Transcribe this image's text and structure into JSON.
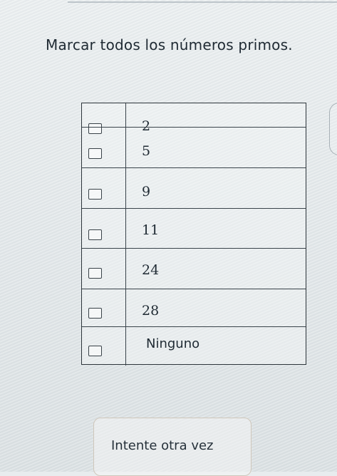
{
  "question": {
    "title": "Marcar todos los números primos."
  },
  "choices": [
    {
      "label": "2"
    },
    {
      "label": "5"
    },
    {
      "label": "9"
    },
    {
      "label": "11"
    },
    {
      "label": "24"
    },
    {
      "label": "28"
    },
    {
      "label": "Ninguno"
    }
  ],
  "actions": {
    "retry_label": "Intente otra vez"
  },
  "colors": {
    "background": "#e8ecee",
    "text": "#1f2a33",
    "border": "#2d353b",
    "button_border": "#cfc7bb"
  }
}
